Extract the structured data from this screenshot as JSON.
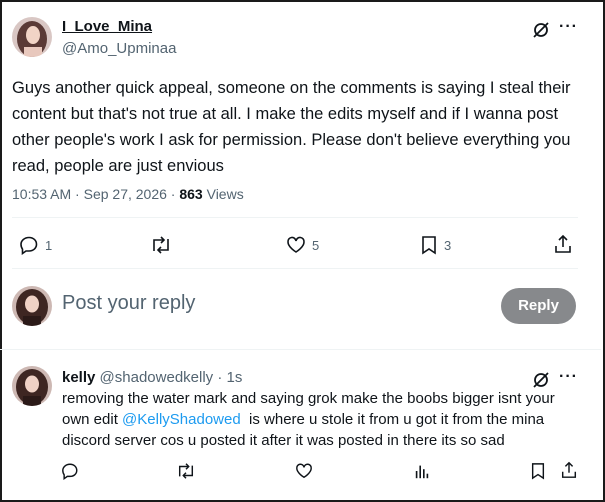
{
  "post": {
    "display_name": "I_Love_Mina",
    "handle": "@Amo_Upminaa",
    "text": "Guys another quick appeal, someone on the comments is saying I steal their content but that's not true at all. I make the edits myself and if I wanna post other people's work I ask for permission. Please don't believe everything you read, people are just envious",
    "time": "10:53 AM",
    "separator": "·",
    "date": "Sep 27, 2026",
    "views_count": "863",
    "views_label": "Views",
    "more_glyph": "···",
    "actions": {
      "replies": "1",
      "reposts": "",
      "likes": "5",
      "bookmarks": "3"
    }
  },
  "reply_box": {
    "placeholder": "Post your reply",
    "button_label": "Reply"
  },
  "reply": {
    "display_name": "kelly",
    "handle": "@shadowedkelly",
    "separator": "·",
    "time": "1s",
    "more_glyph": "···",
    "text_before": "removing the water mark and saying grok make the boobs bigger isnt your own edit ",
    "mention": "@KellyShadowed",
    "text_after": "  is where u stole it from u got it from the mina discord server cos u posted it after it was posted in there its so sad"
  },
  "colors": {
    "accent": "#1d9bf0",
    "muted": "#536471",
    "reply_button": "#87898c",
    "divider": "#eff3f4"
  }
}
